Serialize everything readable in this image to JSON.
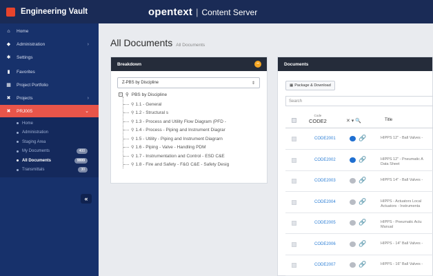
{
  "app": {
    "brand": "Engineering Vault",
    "product_logo": "opentext",
    "product_separator": "|",
    "product_name": "Content Server"
  },
  "sidebar": {
    "items": [
      {
        "label": "Home",
        "icon": "home-icon",
        "glyph": "⌂"
      },
      {
        "label": "Administration",
        "icon": "shield-icon",
        "glyph": "◆",
        "chevron": "›"
      },
      {
        "label": "Settings",
        "icon": "gear-icon",
        "glyph": "✱"
      },
      {
        "label": "Favorites",
        "icon": "bookmark-icon",
        "glyph": "▮"
      },
      {
        "label": "Project Portfolio",
        "icon": "portfolio-icon",
        "glyph": "▦"
      },
      {
        "label": "Projects",
        "icon": "tools-icon",
        "glyph": "✖",
        "chevron": "›"
      },
      {
        "label": "PRJ005",
        "icon": "project-icon",
        "glyph": "✖",
        "chevron": "⌄",
        "active": true
      }
    ],
    "sub_items": [
      {
        "label": "Home"
      },
      {
        "label": "Administration"
      },
      {
        "label": "Staging Area"
      },
      {
        "label": "My Documents",
        "badge": "400"
      },
      {
        "label": "All Documents",
        "badge": "9999",
        "active": true
      },
      {
        "label": "Transmittals",
        "badge": "30"
      }
    ],
    "collapse_glyph": "«"
  },
  "main": {
    "title": "All Documents",
    "subtitle": "All Documents"
  },
  "breakdown": {
    "header": "Breakdown",
    "header_badge": "−",
    "select_value": "Z-PBS by Discipline",
    "select_arrow": "⇕",
    "tree_root": "PBS by Discipline",
    "tree_items": [
      "1.1 - General",
      "1.2 - Structural s",
      "1.3 - Process and Utility Flow Diagram (PFD -",
      "1.4 - Process - Piping and Instrument Diagrar",
      "1.5 - Utility - Piping and Instrument Diagrarn",
      "1.6 - Piping - Valve - Handling PDM",
      "1.7 - Instrumentation and Control - ESD C&E",
      "1.8 - Fire and Safety - F&G C&E - Safety Desig"
    ]
  },
  "documents": {
    "header": "Documents",
    "package_button": "Package & Download",
    "search_placeholder": "Search",
    "col_code_small": "Code",
    "col_code": "CODE2",
    "col_controls": "✕ ▾  🔍",
    "col_title": "Title",
    "rows": [
      {
        "code": "CODE2001",
        "title": "HIPPS 12\" - Ball Valves -",
        "title2": "",
        "bubble_color": "#1f6fd1",
        "clip_color": "#1f6fd1"
      },
      {
        "code": "CODE2002",
        "title": "HIPPS 12\" - Pneumatic A",
        "title2": "Data Sheet",
        "bubble_color": "#1f6fd1",
        "clip_color": "#1f6fd1"
      },
      {
        "code": "CODE2003",
        "title": "HIPPS 14\" - Ball Valves -",
        "title2": "",
        "bubble_color": "#b8bcc4",
        "clip_color": "#b8bcc4"
      },
      {
        "code": "CODE2004",
        "title": "HIPPS - Actuators Local",
        "title2": "Actuators - Instrumenta",
        "bubble_color": "#b8bcc4",
        "clip_color": "#b8bcc4"
      },
      {
        "code": "CODE2005",
        "title": "HIPPS - Pneumatic Actu",
        "title2": "Manual",
        "bubble_color": "#b8bcc4",
        "clip_color": "#b8bcc4"
      },
      {
        "code": "CODE2006",
        "title": "HIPPS - 14\" Ball Valves -",
        "title2": "",
        "bubble_color": "#b8bcc4",
        "clip_color": "#b8bcc4"
      },
      {
        "code": "CODE2007",
        "title": "HIPPS - 16\" Ball Valves -",
        "title2": "",
        "bubble_color": "#b8bcc4",
        "clip_color": "#b8bcc4"
      }
    ]
  }
}
